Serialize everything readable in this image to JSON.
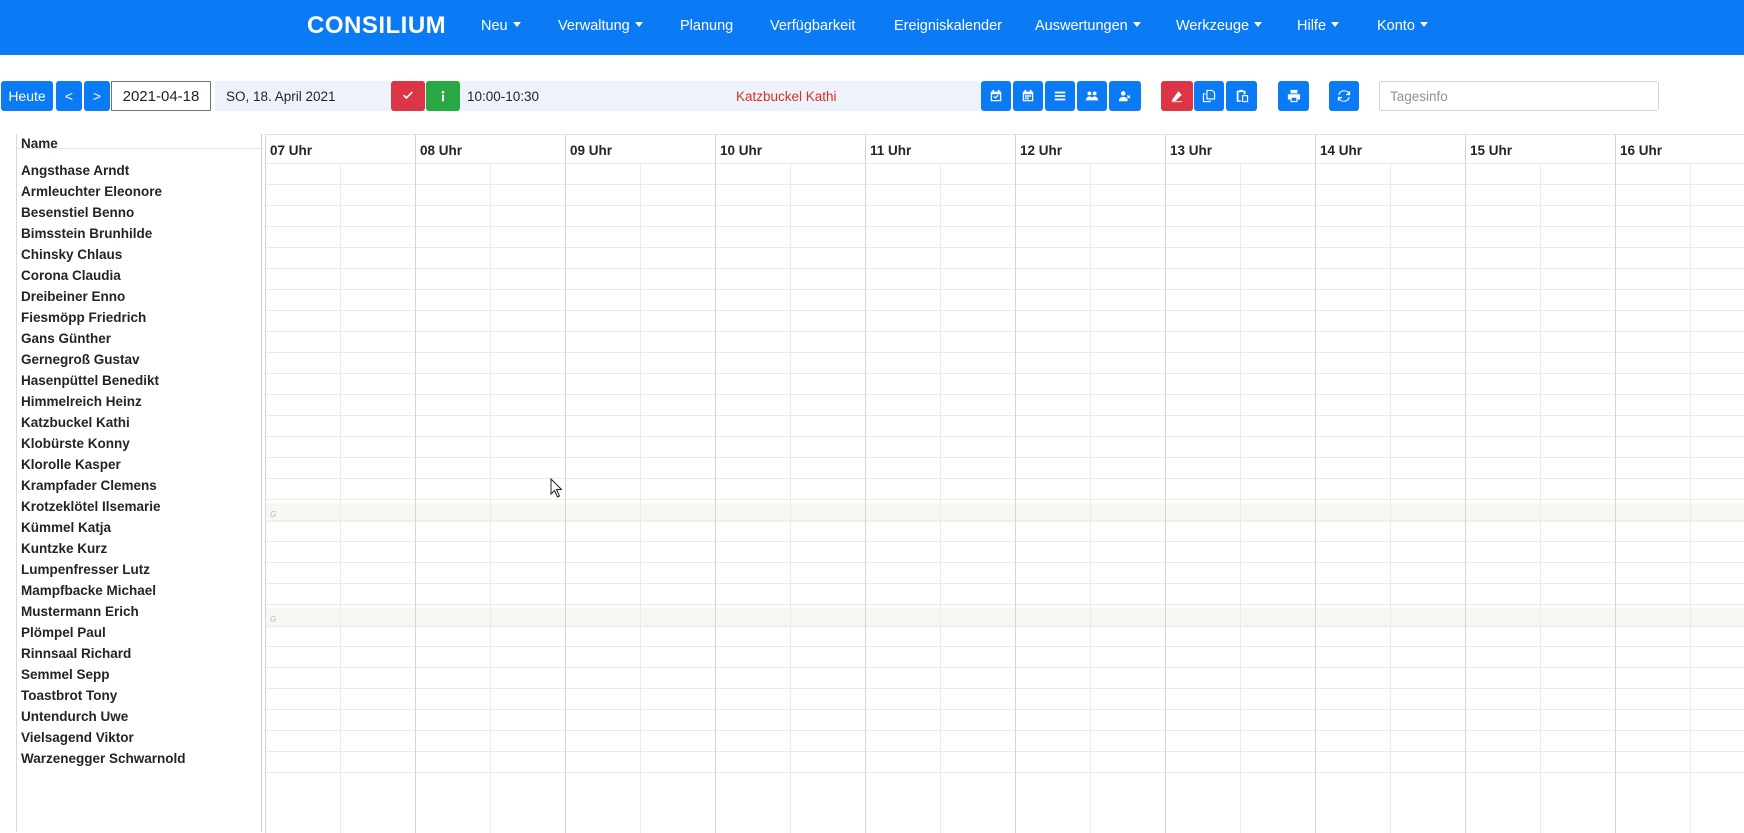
{
  "navbar": {
    "brand": "CONSILIUM",
    "items": [
      {
        "label": "Neu",
        "dropdown": true
      },
      {
        "label": "Verwaltung",
        "dropdown": true
      },
      {
        "label": "Planung",
        "dropdown": false
      },
      {
        "label": "Verfügbarkeit",
        "dropdown": false
      },
      {
        "label": "Ereigniskalender",
        "dropdown": false
      },
      {
        "label": "Auswertungen",
        "dropdown": true
      },
      {
        "label": "Werkzeuge",
        "dropdown": true
      },
      {
        "label": "Hilfe",
        "dropdown": true
      },
      {
        "label": "Konto",
        "dropdown": true
      }
    ]
  },
  "toolbar": {
    "today_label": "Heute",
    "prev_label": "<",
    "next_label": ">",
    "date_value": "2021-04-18",
    "date_long": "SO, 18. April 2021",
    "time_range": "10:00-10:30",
    "selected_person": "Katzbuckel Kathi",
    "tagesinfo_placeholder": "Tagesinfo",
    "icons": [
      "check-icon",
      "info-icon",
      "calendar-check-icon",
      "calendar-icon",
      "list-icon",
      "users-icon",
      "user-remove-icon",
      "eraser-icon",
      "copy-icon",
      "paste-icon",
      "print-icon",
      "refresh-icon"
    ]
  },
  "grid": {
    "name_header": "Name",
    "hours": [
      "07 Uhr",
      "08 Uhr",
      "09 Uhr",
      "10 Uhr",
      "11 Uhr",
      "12 Uhr",
      "13 Uhr",
      "14 Uhr",
      "15 Uhr",
      "16 Uhr"
    ],
    "people": [
      "Angsthase Arndt",
      "Armleuchter Eleonore",
      "Besenstiel Benno",
      "Bimsstein Brunhilde",
      "Chinsky Chlaus",
      "Corona Claudia",
      "Dreibeiner Enno",
      "Fiesmöpp Friedrich",
      "Gans Günther",
      "Gernegroß Gustav",
      "Hasenpüttel Benedikt",
      "Himmelreich Heinz",
      "Katzbuckel Kathi",
      "Klobürste Konny",
      "Klorolle Kasper",
      "Krampfader Clemens",
      "Krotzeklötel Ilsemarie",
      "Kümmel Katja",
      "Kuntzke Kurz",
      "Lumpenfresser Lutz",
      "Mampfbacke Michael",
      "Mustermann Erich",
      "Plömpel Paul",
      "Rinnsaal Richard",
      "Semmel Sepp",
      "Toastbrot Tony",
      "Untendurch Uwe",
      "Vielsagend Viktor",
      "Warzenegger Schwarnold"
    ],
    "marked_rows": [
      {
        "person": "Krotzeklötel Ilsemarie",
        "mark": "G"
      },
      {
        "person": "Mustermann Erich",
        "mark": "G"
      }
    ]
  },
  "colors": {
    "primary": "#0a7bf4",
    "danger": "#dc3545",
    "success": "#28a745",
    "highlight_text": "#d9302c"
  }
}
